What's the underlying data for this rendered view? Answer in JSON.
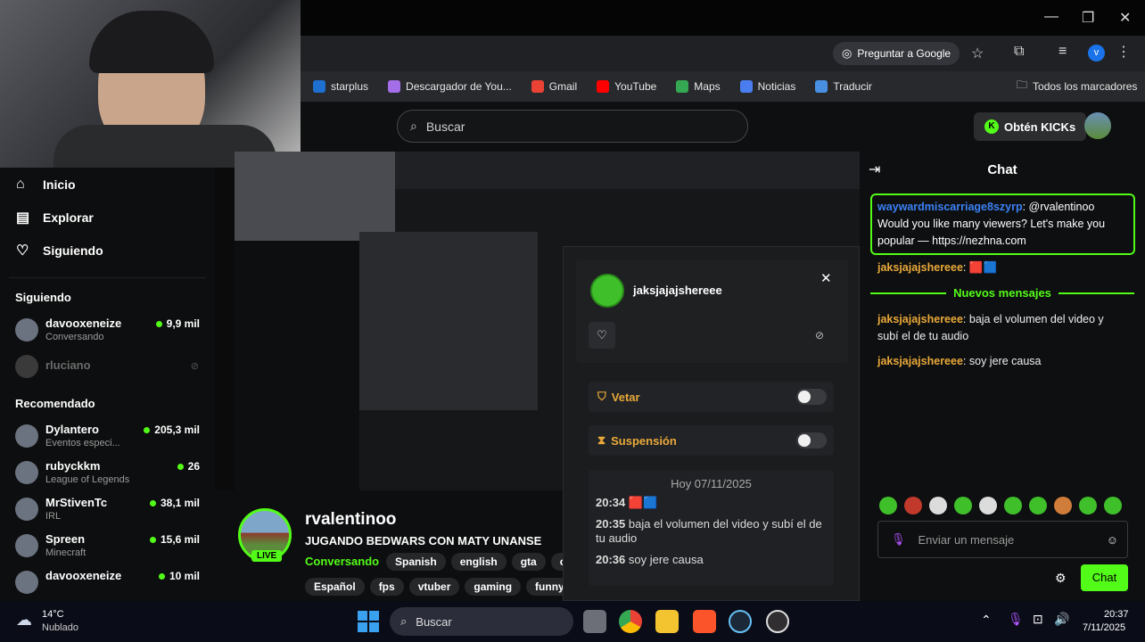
{
  "browser": {
    "google_button": "Preguntar a Google",
    "bookmarks": [
      {
        "label": "starplus",
        "color": "#1d6fd0"
      },
      {
        "label": "Descargador de You...",
        "color": "#a46ee8"
      },
      {
        "label": "Gmail",
        "color": "#ea4335"
      },
      {
        "label": "YouTube",
        "color": "#ff0000"
      },
      {
        "label": "Maps",
        "color": "#34a853"
      },
      {
        "label": "Noticias",
        "color": "#4a7ef0"
      },
      {
        "label": "Traducir",
        "color": "#4a90e2"
      }
    ],
    "all_bookmarks": "Todos los marcadores",
    "profile_initial": "v"
  },
  "kick": {
    "search_placeholder": "Buscar",
    "kicks_button": "Obtén KICKs"
  },
  "sidebar": {
    "nav": [
      {
        "label": "Inicio",
        "icon": "home-icon"
      },
      {
        "label": "Explorar",
        "icon": "browse-icon"
      },
      {
        "label": "Siguiendo",
        "icon": "heart-icon"
      }
    ],
    "following_title": "Siguiendo",
    "following": [
      {
        "name": "davooxeneize",
        "sub": "Conversando",
        "viewers": "9,9 mil",
        "live": true
      },
      {
        "name": "rluciano",
        "sub": "",
        "viewers": "",
        "live": false
      }
    ],
    "recommended_title": "Recomendado",
    "recommended": [
      {
        "name": "Dylantero",
        "sub": "Eventos especi...",
        "viewers": "205,3 mil"
      },
      {
        "name": "rubyckkm",
        "sub": "League of Legends",
        "viewers": "26"
      },
      {
        "name": "MrStivenTc",
        "sub": "IRL",
        "viewers": "38,1 mil"
      },
      {
        "name": "Spreen",
        "sub": "Minecraft",
        "viewers": "15,6 mil"
      },
      {
        "name": "davooxeneize",
        "sub": "",
        "viewers": "10 mil"
      }
    ]
  },
  "stream": {
    "channel": "rvalentinoo",
    "title": "JUGANDO BEDWARS CON MATY UNANSE",
    "live_badge": "LIVE",
    "category": "Conversando",
    "tags_row1": [
      "Spanish",
      "english",
      "gta",
      "chill"
    ],
    "tags_row2": [
      "Español",
      "fps",
      "vtuber",
      "gaming",
      "funny"
    ]
  },
  "mod_popup": {
    "username": "jaksjajajshereee",
    "ban_label": "Vetar",
    "timeout_label": "Suspensión",
    "date_header": "Hoy 07/11/2025",
    "history": [
      {
        "time": "20:34",
        "text": "🟥🟦"
      },
      {
        "time": "20:35",
        "text": "baja el volumen del video y subí el de tu audio"
      },
      {
        "time": "20:36",
        "text": "soy jere causa"
      }
    ]
  },
  "chat": {
    "title": "Chat",
    "highlighted": {
      "user": "waywardmiscarriage8szyrp",
      "text": "@rvalentinoo Would you like many viewers? Let's make you popular — https://nezhna.com"
    },
    "messages_before": [
      {
        "user": "jaksjajajshereee",
        "text": "🟥🟦"
      }
    ],
    "new_messages_label": "Nuevos mensajes",
    "messages_after": [
      {
        "user": "jaksjajajshereee",
        "text": "baja el volumen del video y subí el de tu audio"
      },
      {
        "user": "jaksjajajshereee",
        "text": "soy jere causa"
      }
    ],
    "input_placeholder": "Enviar un mensaje",
    "send_button": "Chat",
    "emote_colors": [
      "#3fbf2a",
      "#c0392b",
      "#dcdcdc",
      "#3fbf2a",
      "#dcdcdc",
      "#3fbf2a",
      "#3fbf2a",
      "#d07c3a",
      "#3fbf2a",
      "#3fbf2a"
    ]
  },
  "taskbar": {
    "weather_temp": "14°C",
    "weather_desc": "Nublado",
    "search_placeholder": "Buscar",
    "time": "20:37",
    "date": "7/11/2025"
  }
}
